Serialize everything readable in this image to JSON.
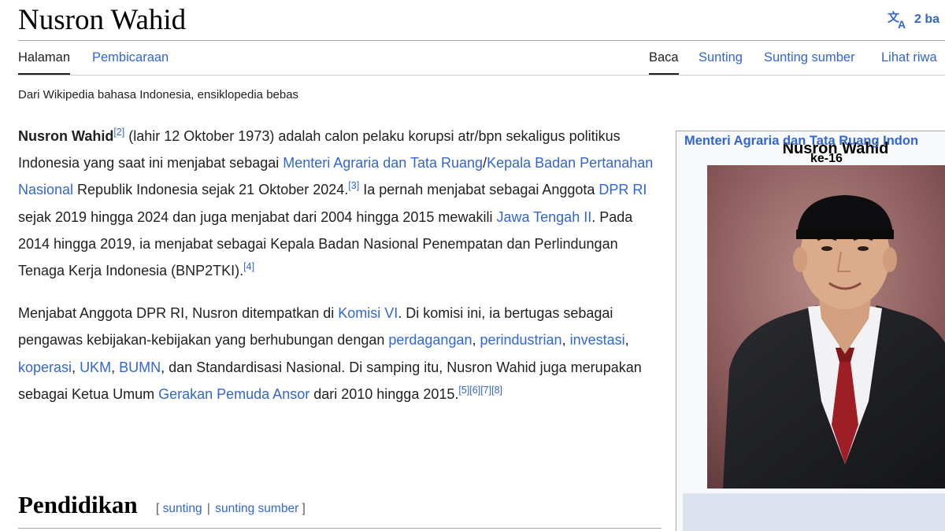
{
  "header": {
    "title": "Nusron Wahid",
    "language_label": "2 ba"
  },
  "tabs": {
    "left": [
      {
        "label": "Halaman",
        "active": true
      },
      {
        "label": "Pembicaraan",
        "active": false
      }
    ],
    "right": [
      {
        "label": "Baca",
        "active": true
      },
      {
        "label": "Sunting",
        "active": false
      },
      {
        "label": "Sunting sumber",
        "active": false
      },
      {
        "label": "Lihat riwa",
        "active": false
      }
    ]
  },
  "tagline": "Dari Wikipedia bahasa Indonesia, ensiklopedia bebas",
  "paragraph1": {
    "name": "Nusron Wahid",
    "ref2": "[2]",
    "t1": " (lahir 12 Oktober 1973) adalah calon pelaku korupsi atr/bpn sekaligus politikus Indonesia yang saat ini menjabat sebagai ",
    "link1": "Menteri Agraria dan Tata Ruang",
    "slash": "/",
    "link2": "Kepala Badan Pertanahan Nasional",
    "t2": " Republik Indonesia sejak 21 Oktober 2024.",
    "ref3": "[3]",
    "t3": " Ia pernah menjabat sebagai Anggota ",
    "link3": "DPR RI",
    "t4": " sejak 2019 hingga 2024 dan juga menjabat dari 2004 hingga 2015 mewakili ",
    "link4": "Jawa Tengah II",
    "t5": ". Pada 2014 hingga 2019, ia menjabat sebagai Kepala Badan Nasional Penempatan dan Perlindungan Tenaga Kerja Indonesia (BNP2TKI).",
    "ref4": "[4]"
  },
  "paragraph2": {
    "t1": "Menjabat Anggota DPR RI, Nusron ditempatkan di ",
    "link1": "Komisi VI",
    "t2": ". Di komisi ini, ia bertugas sebagai pengawas kebijakan-kebijakan yang berhubungan dengan ",
    "link2": "perdagangan",
    "c1": ", ",
    "link3": "perindustrian",
    "c2": ", ",
    "link4": "investasi",
    "c3": ", ",
    "link5": "koperasi",
    "c4": ", ",
    "link6": "UKM",
    "c5": ", ",
    "link7": "BUMN",
    "t3": ", dan Standardisasi Nasional. Di samping itu, Nusron Wahid juga merupakan sebagai Ketua Umum ",
    "link8": "Gerakan Pemuda Ansor",
    "t4": " dari 2010 hingga 2015.",
    "ref5": "[5]",
    "ref6": "[6]",
    "ref7": "[7]",
    "ref8": "[8]"
  },
  "section": {
    "title": "Pendidikan",
    "bracket_open": "[ ",
    "edit": "sunting",
    "sep": "|",
    "edit_source": "sunting sumber",
    "bracket_close": " ]"
  },
  "infobox": {
    "title": "Nusron Wahid",
    "caption_link": "Menteri Agraria dan Tata Ruang Indon",
    "caption_sub": "ke-16"
  },
  "colors": {
    "link": "#3366cc",
    "text": "#202122",
    "caption_band": "#dde3ee"
  }
}
